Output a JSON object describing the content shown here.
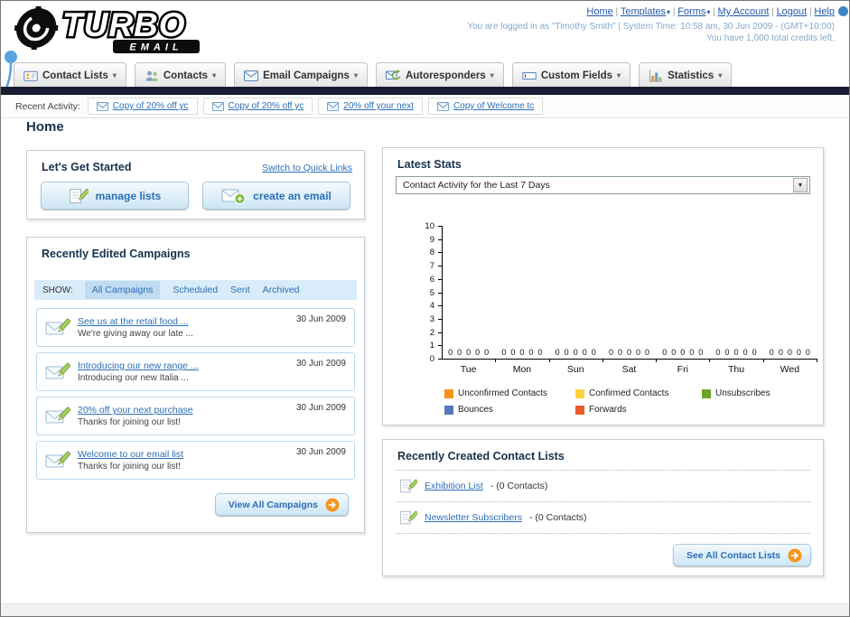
{
  "logo": {
    "line1": "TURBO",
    "line2": "EMAIL"
  },
  "icons": {
    "caret_down": "▾",
    "select_caret": "▼"
  },
  "header": {
    "links": [
      {
        "label": "Home",
        "caret": false
      },
      {
        "label": "Templates",
        "caret": true
      },
      {
        "label": "Forms",
        "caret": true
      },
      {
        "label": "My Account",
        "caret": false
      },
      {
        "label": "Logout",
        "caret": false
      },
      {
        "label": "Help",
        "caret": false
      }
    ],
    "separator": "|",
    "login_info": "You are logged in as \"Timothy Smith\" | System Time: 10:58 am, 30 Jun 2009 - (GMT+10:00)",
    "credits": "You have 1,000 total credits left."
  },
  "nav": {
    "tabs": [
      {
        "label": "Contact Lists",
        "icon": "contact-lists-icon"
      },
      {
        "label": "Contacts",
        "icon": "contacts-icon"
      },
      {
        "label": "Email Campaigns",
        "icon": "email-campaigns-icon"
      },
      {
        "label": "Autoresponders",
        "icon": "autoresponders-icon"
      },
      {
        "label": "Custom Fields",
        "icon": "custom-fields-icon"
      },
      {
        "label": "Statistics",
        "icon": "statistics-icon"
      }
    ]
  },
  "activity": {
    "label": "Recent Activity:",
    "items": [
      {
        "label": "Copy of 20% off yc",
        "icon": "envelope-icon"
      },
      {
        "label": "Copy of 20% off yc",
        "icon": "envelope-icon"
      },
      {
        "label": "20% off your next",
        "icon": "envelope-icon"
      },
      {
        "label": "Copy of Welcome tc",
        "icon": "envelope-icon"
      }
    ]
  },
  "page": {
    "title": "Home"
  },
  "get_started": {
    "title": "Let's Get Started",
    "switch_link": "Switch to Quick Links",
    "buttons": [
      {
        "label": "manage lists",
        "icon": "pencil-icon"
      },
      {
        "label": "create an email",
        "icon": "envelope-plus-icon"
      }
    ]
  },
  "campaigns": {
    "title": "Recently Edited Campaigns",
    "show_label": "SHOW:",
    "filters": [
      "All Campaigns",
      "Scheduled",
      "Sent",
      "Archived"
    ],
    "active_filter": "All Campaigns",
    "items": [
      {
        "title": "See us at the retail food ...",
        "subtitle": "We're giving away our late ...",
        "date": "30 Jun 2009",
        "icon": "envelope-pencil-icon"
      },
      {
        "title": "Introducing our new range ...",
        "subtitle": "Introducing our new Italia ...",
        "date": "30 Jun 2009",
        "icon": "envelope-pencil-icon"
      },
      {
        "title": "20% off your next purchase",
        "subtitle": "Thanks for joining our list!",
        "date": "30 Jun 2009",
        "icon": "envelope-pencil-icon"
      },
      {
        "title": "Welcome to our email list",
        "subtitle": "Thanks for joining our list!",
        "date": "30 Jun 2009",
        "icon": "envelope-pencil-icon"
      }
    ],
    "view_all": {
      "label": "View All Campaigns",
      "icon": "arrow-circle-icon"
    }
  },
  "stats": {
    "title": "Latest Stats",
    "dropdown_value": "Contact Activity for the Last 7 Days",
    "chart_data": {
      "type": "bar",
      "categories": [
        "Tue",
        "Mon",
        "Sun",
        "Sat",
        "Fri",
        "Thu",
        "Wed"
      ],
      "series": [
        {
          "name": "Unconfirmed Contacts",
          "color": "#F7941E",
          "values": [
            0,
            0,
            0,
            0,
            0,
            0,
            0
          ]
        },
        {
          "name": "Confirmed Contacts",
          "color": "#FFD43B",
          "values": [
            0,
            0,
            0,
            0,
            0,
            0,
            0
          ]
        },
        {
          "name": "Unsubscribes",
          "color": "#6BA62B",
          "values": [
            0,
            0,
            0,
            0,
            0,
            0,
            0
          ]
        },
        {
          "name": "Bounces",
          "color": "#5677B9",
          "values": [
            0,
            0,
            0,
            0,
            0,
            0,
            0
          ]
        },
        {
          "name": "Forwards",
          "color": "#EA5B2B",
          "values": [
            0,
            0,
            0,
            0,
            0,
            0,
            0
          ]
        }
      ],
      "ylim": [
        0,
        10
      ],
      "ytick_step": 1,
      "grid": false,
      "legend_position": "bottom",
      "show_value_labels": true
    }
  },
  "contact_lists": {
    "title": "Recently Created Contact Lists",
    "items": [
      {
        "name": "Exhibition List",
        "suffix": " - (0 Contacts)",
        "icon": "list-pencil-icon"
      },
      {
        "name": "Newsletter Subscribers",
        "suffix": " - (0 Contacts)",
        "icon": "list-pencil-icon"
      }
    ],
    "see_all": {
      "label": "See All Contact Lists",
      "icon": "arrow-circle-icon"
    }
  }
}
